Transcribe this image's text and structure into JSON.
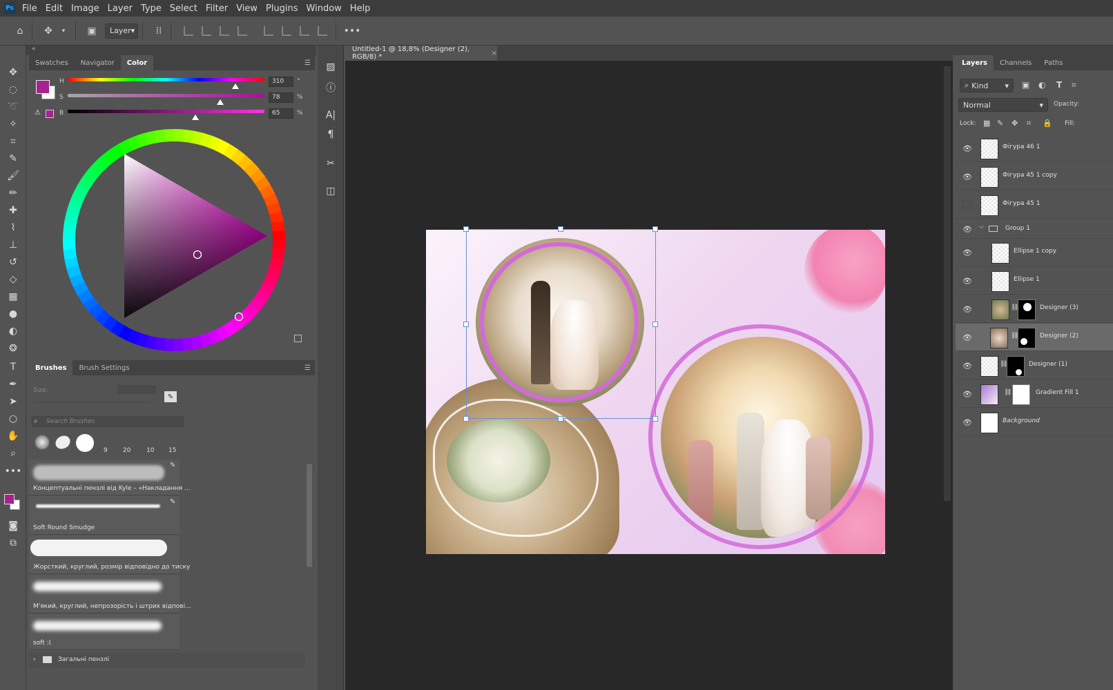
{
  "app": {
    "logo": "Ps"
  },
  "menu": [
    "File",
    "Edit",
    "Image",
    "Layer",
    "Type",
    "Select",
    "Filter",
    "View",
    "Plugins",
    "Window",
    "Help"
  ],
  "options": {
    "auto_select": "Layer"
  },
  "color_panel": {
    "tabs": [
      "Swatches",
      "Navigator",
      "Color"
    ],
    "labels": {
      "h": "H",
      "s": "S",
      "b": "B"
    },
    "h": "310",
    "s": "78",
    "b": "65",
    "units": {
      "h": "°",
      "s": "%",
      "b": "%"
    },
    "fg_color": "#a6238f"
  },
  "brushes": {
    "tabs": [
      "Brushes",
      "Brush Settings"
    ],
    "size_label": "Size:",
    "search_placeholder": "Search Brushes",
    "presets": [
      "9",
      "20",
      "10",
      "15"
    ],
    "items": [
      "Концептуальні пензлі від Kyle – «Накладання ...",
      "Soft Round Smudge",
      "Жорсткий, круглий, розмір відповідно до тиску",
      "М'який, круглий, непрозорість і штрих відпові...",
      "soft :("
    ],
    "folder": "Загальні пензлі"
  },
  "document": {
    "tab_title": "Untitled-1 @ 18,8% (Designer (2), RGB/8) *",
    "close": "×"
  },
  "layers_panel": {
    "tabs": [
      "Layers",
      "Channels",
      "Paths"
    ],
    "filter": "Kind",
    "blend_mode": "Normal",
    "opacity_label": "Opacity:",
    "lock_label": "Lock:",
    "fill_label": "Fill:",
    "layers": [
      {
        "name": "Фігура 46 1",
        "visible": true
      },
      {
        "name": "Фігура 45 1 copy",
        "visible": true
      },
      {
        "name": "Фігура 45 1",
        "visible": false
      },
      {
        "name": "Group 1",
        "visible": true
      },
      {
        "name": "Ellipse 1 copy",
        "visible": true
      },
      {
        "name": "Ellipse 1",
        "visible": true
      },
      {
        "name": "Designer (3)",
        "visible": true
      },
      {
        "name": "Designer (2)",
        "visible": true,
        "selected": true
      },
      {
        "name": "Designer (1)",
        "visible": true
      },
      {
        "name": "Gradient Fill 1",
        "visible": true
      },
      {
        "name": "Background",
        "visible": true
      }
    ]
  }
}
